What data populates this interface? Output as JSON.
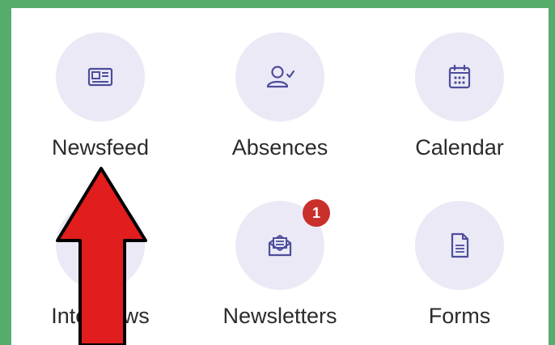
{
  "menu": {
    "items": [
      {
        "label": "Newsfeed",
        "icon": "newspaper-icon"
      },
      {
        "label": "Absences",
        "icon": "user-check-icon"
      },
      {
        "label": "Calendar",
        "icon": "calendar-icon"
      },
      {
        "label": "Interviews",
        "icon": "interviews-icon"
      },
      {
        "label": "Newsletters",
        "icon": "envelope-open-icon",
        "badge": "1"
      },
      {
        "label": "Forms",
        "icon": "document-icon"
      }
    ]
  },
  "colors": {
    "frame_border": "#56ad6b",
    "icon_bg": "#ebe9f5",
    "icon": "#4d4d9c",
    "badge": "#c9302c",
    "arrow": "#e11d1d"
  }
}
